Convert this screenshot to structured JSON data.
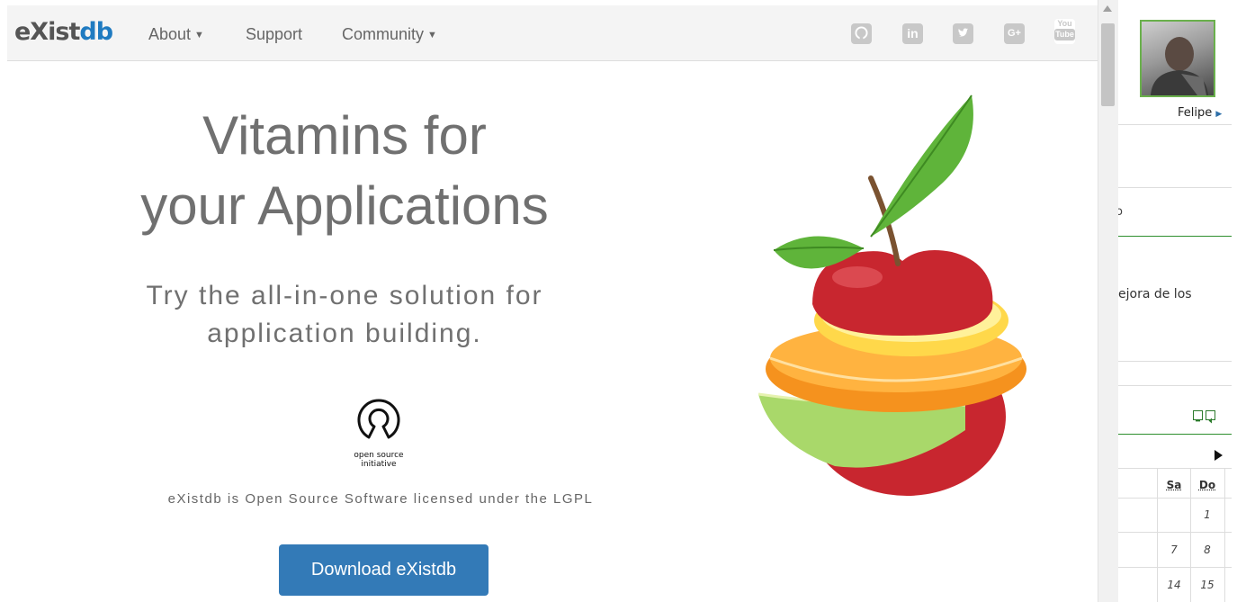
{
  "nav": {
    "logo_part1": "eXist",
    "logo_part2": "db",
    "items": [
      {
        "label": "About",
        "has_dropdown": true
      },
      {
        "label": "Support",
        "has_dropdown": false
      },
      {
        "label": "Community",
        "has_dropdown": true
      }
    ],
    "social_icons": [
      "github-icon",
      "linkedin-icon",
      "twitter-icon",
      "google-plus-icon",
      "youtube-icon"
    ],
    "linkedin_text": "in",
    "gplus_text": "G+",
    "youtube_text_top": "You",
    "youtube_text_bottom": "Tube"
  },
  "hero": {
    "title_line1": "Vitamins for",
    "title_line2": "your Applications",
    "subtitle_line1": "Try the all-in-one solution for",
    "subtitle_line2": "application building.",
    "osi_line1": "open source",
    "osi_line2": "initiative",
    "license_text": "eXistdb is Open Source Software licensed under the LGPL",
    "download_label": "Download eXistdb"
  },
  "side_panel": {
    "user_name": "Felipe",
    "fragment_char": "o",
    "text_fragment": "ejora de los",
    "calendar": {
      "headers": [
        "Sa",
        "Do"
      ],
      "rows": [
        [
          "",
          "1"
        ],
        [
          "7",
          "8"
        ],
        [
          "14",
          "15"
        ]
      ]
    }
  },
  "colors": {
    "brand_blue": "#1f7bc1",
    "button_blue": "#337ab7",
    "accent_green": "#2f8f2f"
  }
}
